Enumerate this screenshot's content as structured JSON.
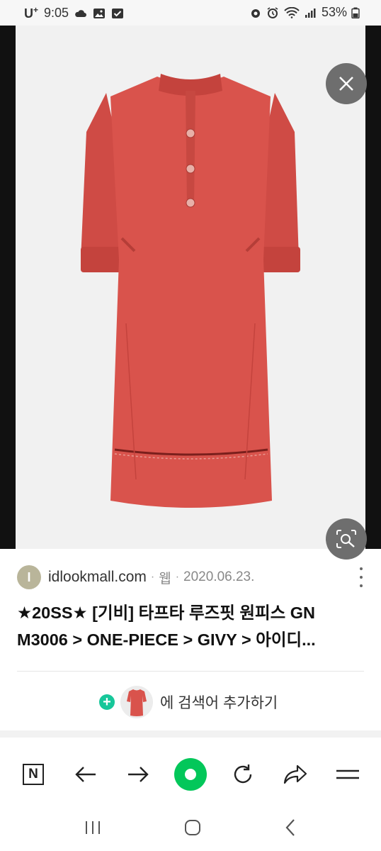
{
  "status_bar": {
    "carrier": "U",
    "carrier_sup": "+",
    "time": "9:05",
    "battery": "53%"
  },
  "viewer": {
    "image_alt": "red shirt dress"
  },
  "result": {
    "favicon_letter": "I",
    "domain": "idlookmall.com",
    "dot1": "·",
    "type": "웹",
    "dot2": "·",
    "date": "2020.06.23.",
    "title_line1": "★20SS★ [기비] 타프타 루즈핏 원피스 GN",
    "title_line2": "M3006 > ONE-PIECE > GIVY > 아이디...",
    "add_plus": "+",
    "add_label": "에 검색어 추가하기"
  },
  "toolbar": {
    "n_label": "N"
  },
  "colors": {
    "accent_green": "#03c75a",
    "plus_green": "#17c79a",
    "dress_red": "#d9534c"
  },
  "icons": [
    "cloud-icon",
    "gallery-icon",
    "check-icon",
    "alarm-icon",
    "wifi-icon",
    "signal-icon",
    "battery-icon",
    "close-icon",
    "lens-search-icon",
    "more-icon",
    "back-arrow-icon",
    "forward-arrow-icon",
    "reload-icon",
    "share-icon",
    "menu-icon",
    "recents-icon",
    "home-icon",
    "back-icon"
  ]
}
